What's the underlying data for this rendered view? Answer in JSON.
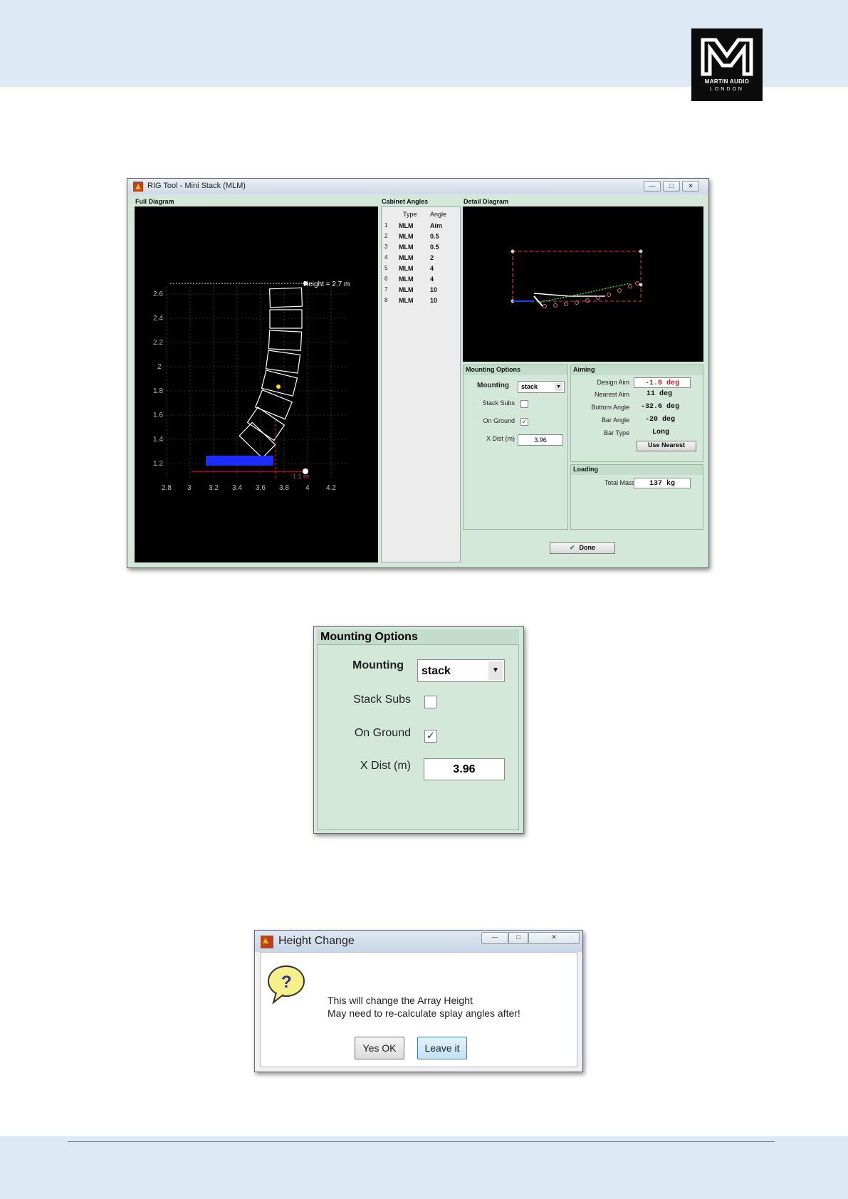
{
  "branding": {
    "logo_line1": "MARTIN AUDIO",
    "logo_line2": "LONDON"
  },
  "rig_window": {
    "title": "RIG Tool - Mini Stack (MLM)",
    "full_diagram_label": "Full Diagram",
    "cabinet_angles_label": "Cabinet Angles",
    "detail_diagram_label": "Detail Diagram",
    "height_annotation": "Height = 2.7 m",
    "distance_annotation": "1.1 m",
    "x_ticks": [
      "2.8",
      "3",
      "3.2",
      "3.4",
      "3.6",
      "3.8",
      "4",
      "4.2"
    ],
    "y_ticks": [
      "1.2",
      "1.4",
      "1.6",
      "1.8",
      "2",
      "2.2",
      "2.4",
      "2.6"
    ],
    "table": {
      "headers": [
        "Type",
        "Angle"
      ],
      "rows": [
        {
          "n": "1",
          "type": "MLM",
          "angle": "Aim"
        },
        {
          "n": "2",
          "type": "MLM",
          "angle": "0.5"
        },
        {
          "n": "3",
          "type": "MLM",
          "angle": "0.5"
        },
        {
          "n": "4",
          "type": "MLM",
          "angle": "2"
        },
        {
          "n": "5",
          "type": "MLM",
          "angle": "4"
        },
        {
          "n": "6",
          "type": "MLM",
          "angle": "4"
        },
        {
          "n": "7",
          "type": "MLM",
          "angle": "10"
        },
        {
          "n": "8",
          "type": "MLM",
          "angle": "10"
        }
      ]
    },
    "mounting_options": {
      "title": "Mounting Options",
      "mounting_label": "Mounting",
      "mounting_value": "stack",
      "stack_subs_label": "Stack Subs",
      "stack_subs_checked": false,
      "on_ground_label": "On Ground",
      "on_ground_checked": true,
      "x_dist_label": "X Dist (m)",
      "x_dist_value": "3.96"
    },
    "aiming": {
      "title": "Aiming",
      "design_aim_label": "Design Aim",
      "design_aim_value": "-1.6 deg",
      "nearest_aim_label": "Nearest Aim",
      "nearest_aim_value": "11 deg",
      "bottom_angle_label": "Bottom Angle",
      "bottom_angle_value": "-32.6 deg",
      "bar_angle_label": "Bar Angle",
      "bar_angle_value": "-20 deg",
      "bar_type_label": "Bar Type",
      "bar_type_value": "Long",
      "use_nearest_label": "Use Nearest"
    },
    "loading": {
      "title": "Loading",
      "total_mass_label": "Total Mass",
      "total_mass_value": "137 kg"
    },
    "done_label": "Done"
  },
  "zoom_panel": {
    "title": "Mounting Options",
    "mounting_label": "Mounting",
    "mounting_value": "stack",
    "stack_subs_label": "Stack Subs",
    "on_ground_label": "On Ground",
    "x_dist_label": "X Dist (m)",
    "x_dist_value": "3.96"
  },
  "dialog": {
    "title": "Height Change",
    "message_line1": "This will change the Array Height",
    "message_line2": "May need to re-calculate splay angles after!",
    "yes_label": "Yes OK",
    "leave_label": "Leave it"
  },
  "colors": {
    "page_band": "#dde9f4",
    "window_green": "#d4e8d9",
    "design_aim_red": "#c0202f"
  }
}
